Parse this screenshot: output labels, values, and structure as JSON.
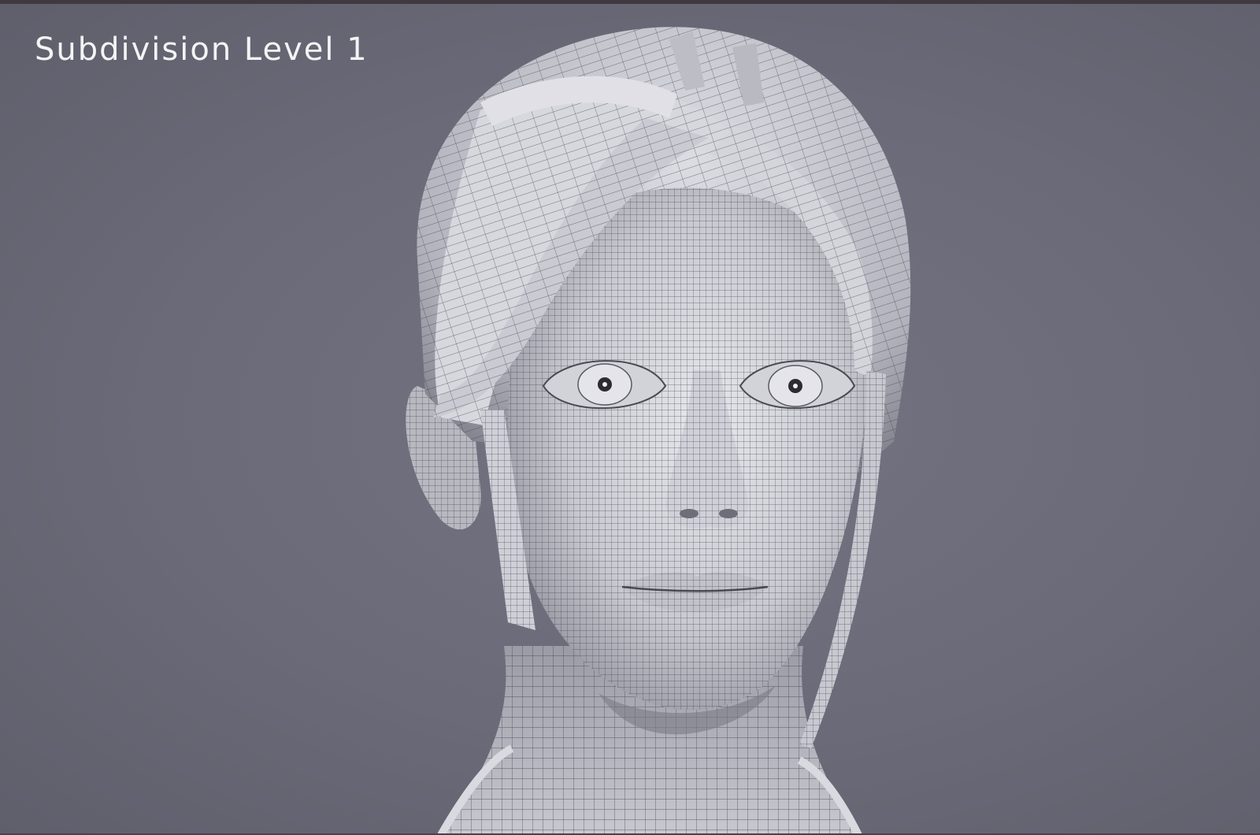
{
  "viewport": {
    "label": "Subdivision Level 1",
    "background_color": "#6b6b79",
    "mesh_color": "#d8d8df",
    "wire_color": "#3a3a42"
  },
  "model": {
    "icon": "wireframe-head-render"
  }
}
